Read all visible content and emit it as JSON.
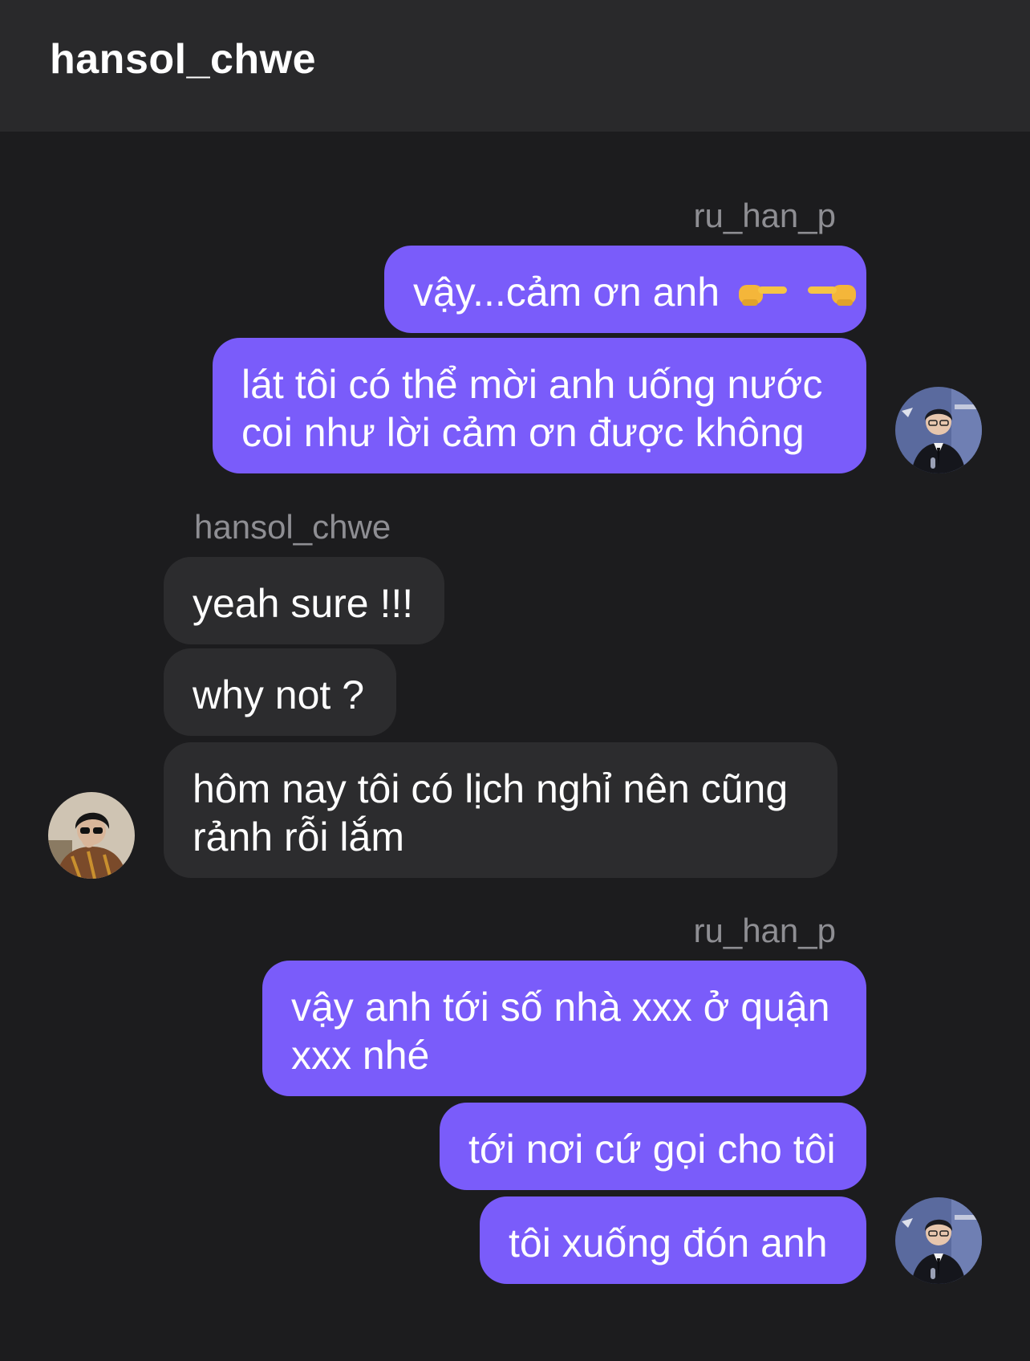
{
  "header": {
    "title": "hansol_chwe"
  },
  "groups": [
    {
      "sender": "ru_han_p",
      "messages": [
        "vậy...cảm ơn anh",
        "lát tôi có thể mời anh uống nước\ncoi như lời cảm ơn được không"
      ]
    },
    {
      "sender": "hansol_chwe",
      "messages": [
        "yeah sure !!!",
        "why not ?",
        "hôm nay tôi có lịch nghỉ nên cũng\nrảnh rỗi lắm"
      ]
    },
    {
      "sender": "ru_han_p",
      "messages": [
        "vậy anh tới số nhà xxx ở quận\nxxx nhé",
        "tới nơi cứ gọi cho tôi",
        "tôi xuống đón anh"
      ]
    }
  ],
  "icons": {
    "emoji_1": "pointing-right-hand-emoji",
    "emoji_2": "pointing-left-hand-emoji"
  },
  "colors": {
    "outgoing_bubble": "#7a5cfa",
    "incoming_bubble": "#2c2c2e",
    "background": "#1c1c1e",
    "header": "#29292b",
    "sender_label": "#8e8e93"
  }
}
